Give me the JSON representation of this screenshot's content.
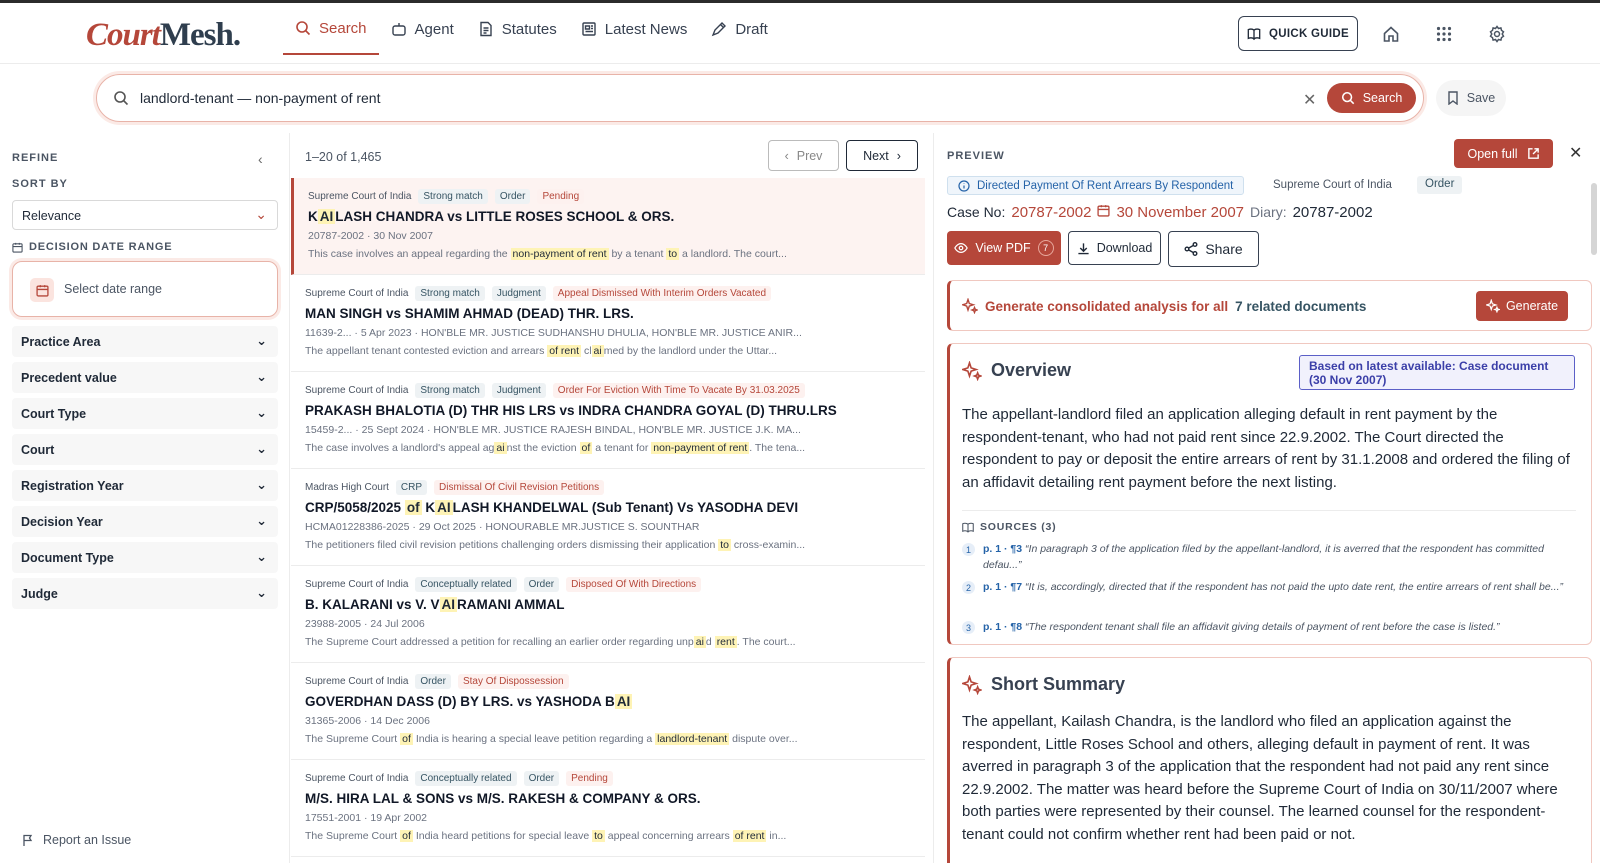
{
  "app": {
    "logo_part1": "Court",
    "logo_part2": "Mesh.",
    "brand_color": "#b5473a"
  },
  "nav": {
    "items": [
      {
        "label": "Search",
        "icon": "search-icon",
        "active": true
      },
      {
        "label": "Agent",
        "icon": "robot-icon",
        "active": false
      },
      {
        "label": "Statutes",
        "icon": "document-icon",
        "active": false
      },
      {
        "label": "Latest News",
        "icon": "newspaper-icon",
        "active": false
      },
      {
        "label": "Draft",
        "icon": "pen-icon",
        "active": false
      }
    ],
    "quick_guide": "QUICK GUIDE"
  },
  "search": {
    "query": "landlord-tenant — non-payment of rent",
    "button": "Search",
    "save": "Save"
  },
  "sidebar": {
    "refine": "REFINE",
    "sort_by": "SORT BY",
    "sort_value": "Relevance",
    "date_range_label": "DECISION DATE RANGE",
    "date_placeholder": "Select date range",
    "filters": [
      "Practice Area",
      "Precedent value",
      "Court Type",
      "Court",
      "Registration Year",
      "Decision Year",
      "Document Type",
      "Judge"
    ],
    "report": "Report an Issue"
  },
  "results": {
    "count": "1–20 of 1,465",
    "prev": "Prev",
    "next": "Next",
    "items": [
      {
        "court": "Supreme Court of India",
        "tags": [
          "Strong match",
          "Order"
        ],
        "status": "Pending",
        "title": [
          [
            "K",
            false
          ],
          [
            "AI",
            true
          ],
          [
            "LASH CHANDRA vs LITTLE ROSES SCHOOL & ORS.",
            false
          ]
        ],
        "meta": "20787-2002 · 30 Nov 2007",
        "snippet": [
          [
            "This case involves an appeal regarding the ",
            false
          ],
          [
            "non-payment of rent",
            true
          ],
          [
            " by a tenant ",
            false
          ],
          [
            "to",
            true
          ],
          [
            " a landlord. The court...",
            false
          ]
        ]
      },
      {
        "court": "Supreme Court of India",
        "tags": [
          "Strong match",
          "Judgment"
        ],
        "status": "Appeal Dismissed With Interim Orders Vacated",
        "title": [
          [
            "MAN SINGH vs SHAMIM AHMAD (DEAD) THR. LRS.",
            false
          ]
        ],
        "meta": "11639-2... · 5 Apr 2023 · HON'BLE MR. JUSTICE SUDHANSHU DHULIA, HON'BLE MR. JUSTICE ANIR...",
        "snippet": [
          [
            "The appellant tenant contested eviction and arrears ",
            false
          ],
          [
            "of rent",
            true
          ],
          [
            " cl",
            false
          ],
          [
            "ai",
            true
          ],
          [
            "med by the landlord under the Uttar...",
            false
          ]
        ]
      },
      {
        "court": "Supreme Court of India",
        "tags": [
          "Strong match",
          "Judgment"
        ],
        "status": "Order For Eviction With Time To Vacate By 31.03.2025",
        "title": [
          [
            "PRAKASH BHALOTIA (D) THR HIS LRS vs INDRA CHANDRA GOYAL (D) THRU.LRS",
            false
          ]
        ],
        "meta": "15459-2... · 25 Sept 2024 · HON'BLE MR. JUSTICE RAJESH BINDAL, HON'BLE MR. JUSTICE J.K. MA...",
        "snippet": [
          [
            "The case involves a landlord's appeal ag",
            false
          ],
          [
            "ai",
            true
          ],
          [
            "nst the eviction ",
            false
          ],
          [
            "of",
            true
          ],
          [
            " a tenant for ",
            false
          ],
          [
            "non-payment of rent",
            true
          ],
          [
            ". The tena...",
            false
          ]
        ]
      },
      {
        "court": "Madras High Court",
        "tags": [
          "CRP"
        ],
        "status": "Dismissal Of Civil Revision Petitions",
        "title": [
          [
            "CRP/5058/2025 ",
            false
          ],
          [
            "of",
            true
          ],
          [
            " K",
            false
          ],
          [
            "AI",
            true
          ],
          [
            "LASH KHANDELWAL (Sub Tenant) Vs YASODHA DEVI",
            false
          ]
        ],
        "meta": "HCMA01228386-2025 · 29 Oct 2025 · HONOURABLE MR.JUSTICE S. SOUNTHAR",
        "snippet": [
          [
            "The petitioners filed civil revision petitions challenging orders dismissing their application ",
            false
          ],
          [
            "to",
            true
          ],
          [
            " cross-examin...",
            false
          ]
        ]
      },
      {
        "court": "Supreme Court of India",
        "tags": [
          "Conceptually related",
          "Order"
        ],
        "status": "Disposed Of With Directions",
        "title": [
          [
            "B. KALARANI vs V. V",
            false
          ],
          [
            "AI",
            true
          ],
          [
            "RAMANI AMMAL",
            false
          ]
        ],
        "meta": "23988-2005 · 24 Jul 2006",
        "snippet": [
          [
            "The Supreme Court addressed a petition for recalling an earlier order regarding unp",
            false
          ],
          [
            "ai",
            true
          ],
          [
            "d ",
            false
          ],
          [
            "rent",
            true
          ],
          [
            ". The court...",
            false
          ]
        ]
      },
      {
        "court": "Supreme Court of India",
        "tags": [
          "Order"
        ],
        "status": "Stay Of Dispossession",
        "title": [
          [
            "GOVERDHAN DASS (D) BY LRS. vs YASHODA B",
            false
          ],
          [
            "AI",
            true
          ]
        ],
        "meta": "31365-2006 · 14 Dec 2006",
        "snippet": [
          [
            "The Supreme Court ",
            false
          ],
          [
            "of",
            true
          ],
          [
            " India is hearing a special leave petition regarding a ",
            false
          ],
          [
            "landlord-tenant",
            true
          ],
          [
            " dispute over...",
            false
          ]
        ]
      },
      {
        "court": "Supreme Court of India",
        "tags": [
          "Conceptually related",
          "Order"
        ],
        "status": "Pending",
        "title": [
          [
            "M/S. HIRA LAL & SONS vs M/S. RAKESH & COMPANY & ORS.",
            false
          ]
        ],
        "meta": "17551-2001 · 19 Apr 2002",
        "snippet": [
          [
            "The Supreme Court ",
            false
          ],
          [
            "of",
            true
          ],
          [
            " India heard petitions for special leave ",
            false
          ],
          [
            "to",
            true
          ],
          [
            " appeal concerning arrears ",
            false
          ],
          [
            "of rent",
            true
          ],
          [
            " in...",
            false
          ]
        ]
      }
    ]
  },
  "preview": {
    "label": "PREVIEW",
    "open_full": "Open full",
    "issue": "Directed Payment Of Rent Arrears By Respondent",
    "court": "Supreme Court of India",
    "type": "Order",
    "case_no_label": "Case No:",
    "case_no": "20787-2002",
    "date": "30 November 2007",
    "diary_label": "Diary:",
    "diary": "20787-2002",
    "view_pdf": "View PDF",
    "pdf_count": "7",
    "download": "Download",
    "share": "Share",
    "generate_text_1": "Generate consolidated analysis for all",
    "generate_text_2": "7 related documents",
    "generate_btn": "Generate",
    "overview_title": "Overview",
    "based_on": "Based on latest available: Case document (30 Nov 2007)",
    "overview_body": "The appellant-landlord filed an application alleging default in rent payment by the respondent-tenant, who had not paid rent since 22.9.2002. The Court directed the respondent to pay or deposit the entire arrears of rent by 31.1.2008 and ordered the filing of an affidavit detailing rent payment before the next listing.",
    "sources_label": "SOURCES (3)",
    "sources": [
      {
        "n": "1",
        "ref": "p. 1 · ¶3",
        "quote": "“In paragraph 3 of the application filed by the appellant-landlord, it is averred that the respondent has committed defau...”"
      },
      {
        "n": "2",
        "ref": "p. 1 · ¶7",
        "quote": "“It is, accordingly, directed that if the respondent has not paid the upto date rent, the entire arrears of rent shall be...”"
      },
      {
        "n": "3",
        "ref": "p. 1 · ¶8",
        "quote": "“The respondent tenant shall file an affidavit giving details of payment of rent before the case is listed.”"
      }
    ],
    "summary_title": "Short Summary",
    "summary_body": "The appellant, Kailash Chandra, is the landlord who filed an application against the respondent, Little Roses School and others, alleging default in payment of rent. It was averred in paragraph 3 of the application that the respondent had not paid any rent since 22.9.2002. The matter was heard before the Supreme Court of India on 30/11/2007 where both parties were represented by their counsel. The learned counsel for the respondent-tenant could not confirm whether rent had been paid or not."
  }
}
